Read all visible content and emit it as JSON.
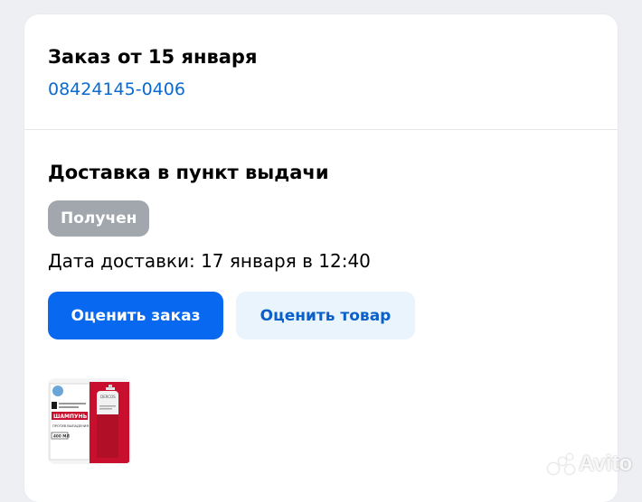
{
  "order": {
    "title": "Заказ от 15 января",
    "number": "08424145-0406"
  },
  "delivery": {
    "title": "Доставка в пункт выдачи",
    "status": "Получен",
    "date_text": "Дата доставки: 17 января в 12:40"
  },
  "actions": {
    "rate_order": "Оценить заказ",
    "rate_product": "Оценить товар"
  },
  "product": {
    "box_text": "ШАМПУНЬ",
    "box_sub": "ПРОТИВ ВЫПАДЕНИЯ ВОЛОС",
    "box_volume": "400 МЛ",
    "bottle_label": "DERCOS"
  },
  "watermark": "Avito",
  "colors": {
    "accent": "#0968f0",
    "link": "#0a6ad0",
    "badge": "#a2a7ae",
    "secondary_bg": "#eaf4fc",
    "product_red": "#c8102e"
  }
}
